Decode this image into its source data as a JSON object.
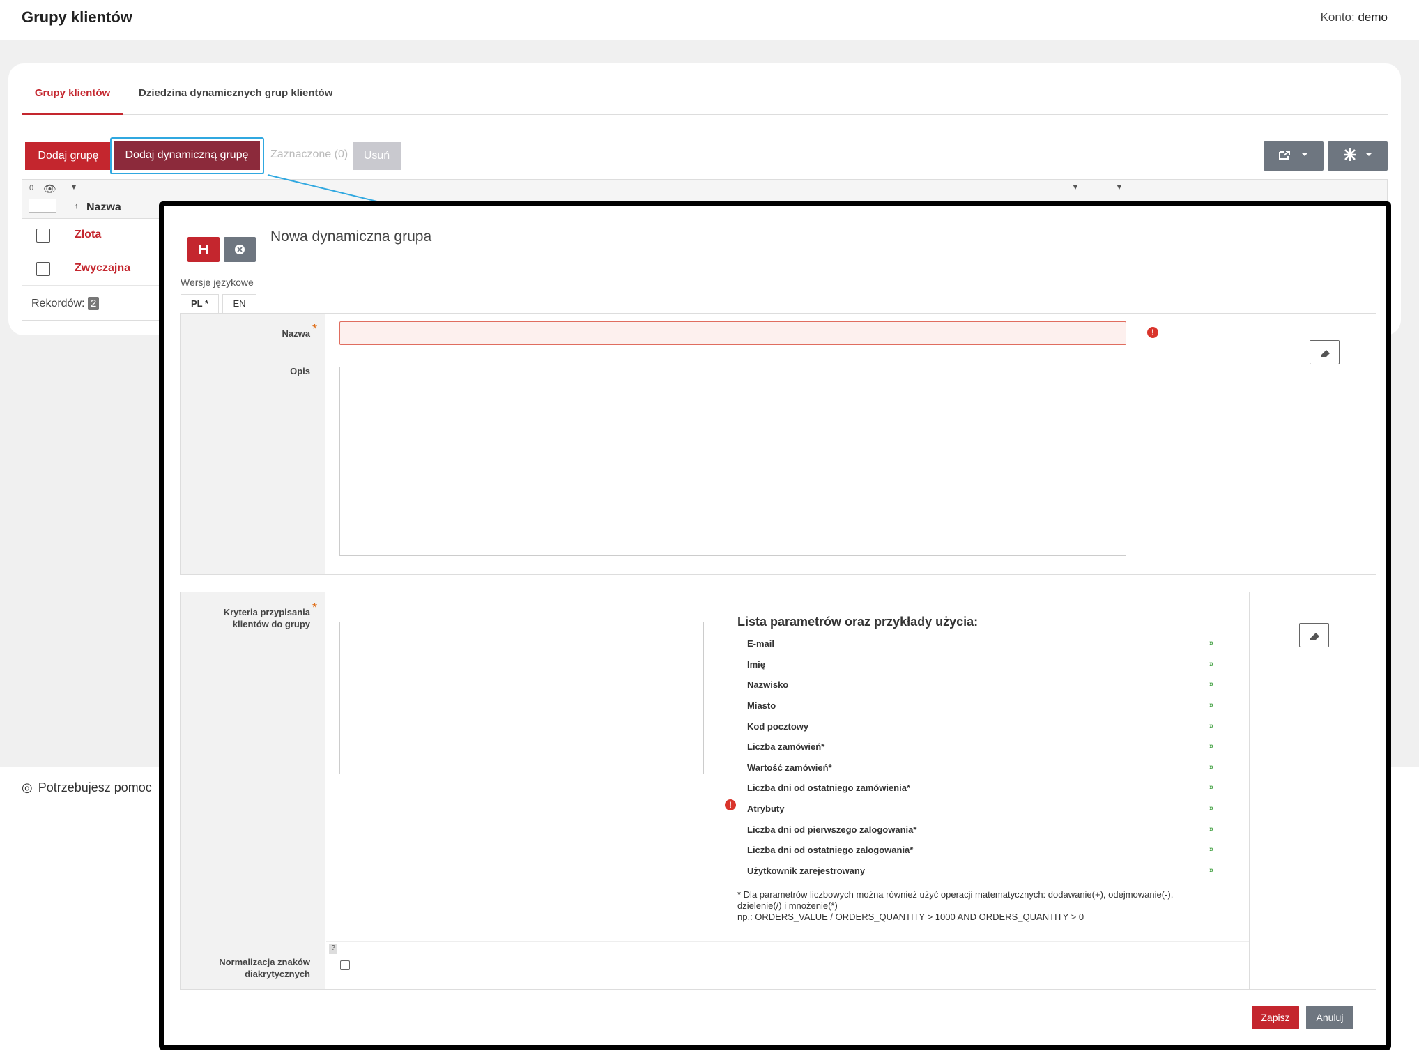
{
  "header": {
    "title": "Grupy klientów",
    "account_label": "Konto:",
    "account_name": "demo"
  },
  "tabs": [
    {
      "label": "Grupy klientów",
      "active": true
    },
    {
      "label": "Dziedzina dynamicznych grup klientów",
      "active": false
    }
  ],
  "toolbar": {
    "add_group": "Dodaj grupę",
    "add_dynamic_group": "Dodaj dynamiczną grupę",
    "selected": "Zaznaczone (0)",
    "delete": "Usuń"
  },
  "table": {
    "visible_count": "0",
    "column_name": "Nazwa",
    "rows": [
      "Złota",
      "Zwyczajna"
    ],
    "records_label": "Rekordów:",
    "records_count": "2"
  },
  "help_text": "Potrzebujesz pomoc",
  "modal": {
    "title": "Nowa dynamiczna grupa",
    "language_versions_label": "Wersje językowe",
    "languages": [
      "PL *",
      "EN"
    ],
    "name_label": "Nazwa",
    "name_value": "",
    "description_label": "Opis",
    "criteria_label_1": "Kryteria przypisania",
    "criteria_label_2": "klientów do grupy",
    "params_title": "Lista parametrów oraz przykłady użycia:",
    "params": [
      "E-mail",
      "Imię",
      "Nazwisko",
      "Miasto",
      "Kod pocztowy",
      "Liczba zamówień*",
      "Wartość zamówień*",
      "Liczba dni od ostatniego zamówienia*",
      "Atrybuty",
      "Liczba dni od pierwszego zalogowania*",
      "Liczba dni od ostatniego zalogowania*",
      "Użytkownik zarejestrowany"
    ],
    "note_1": "* Dla parametrów liczbowych można również użyć operacji matematycznych: dodawanie(+), odejmowanie(-),",
    "note_2": "dzielenie(/) i mnożenie(*)",
    "note_3": "np.: ORDERS_VALUE / ORDERS_QUANTITY > 1000 AND ORDERS_QUANTITY > 0",
    "normalization_label_1": "Normalizacja znaków",
    "normalization_label_2": "diakrytycznych",
    "help_mark": "?",
    "save": "Zapisz",
    "cancel": "Anuluj"
  },
  "colors": {
    "accent": "#c4262e",
    "highlight": "#30a8e0",
    "success": "#47a347"
  }
}
